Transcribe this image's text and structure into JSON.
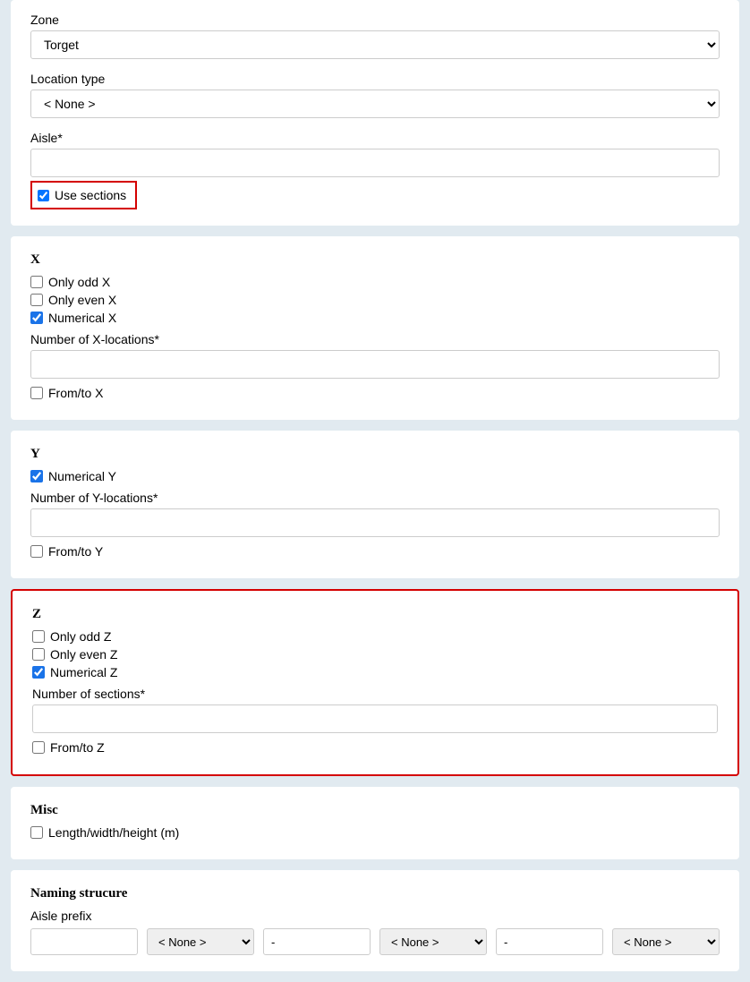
{
  "top": {
    "zone_label": "Zone",
    "zone_value": "Torget",
    "location_type_label": "Location type",
    "location_type_value": "< None >",
    "aisle_label": "Aisle*",
    "aisle_value": "",
    "use_sections_label": "Use sections"
  },
  "x": {
    "title": "X",
    "only_odd": "Only odd X",
    "only_even": "Only even X",
    "numerical": "Numerical X",
    "number_label": "Number of X-locations*",
    "number_value": "",
    "from_to": "From/to X"
  },
  "y": {
    "title": "Y",
    "numerical": "Numerical Y",
    "number_label": "Number of Y-locations*",
    "number_value": "",
    "from_to": "From/to Y"
  },
  "z": {
    "title": "Z",
    "only_odd": "Only odd Z",
    "only_even": "Only even Z",
    "numerical": "Numerical Z",
    "number_label": "Number of sections*",
    "number_value": "",
    "from_to": "From/to Z"
  },
  "misc": {
    "title": "Misc",
    "lwh": "Length/width/height (m)"
  },
  "naming": {
    "title": "Naming strucure",
    "aisle_prefix_label": "Aisle prefix",
    "aisle_prefix_value": "",
    "sep1_value": "< None >",
    "dash1": "-",
    "sep2_value": "< None >",
    "dash2": "-",
    "sep3_value": "< None >"
  }
}
